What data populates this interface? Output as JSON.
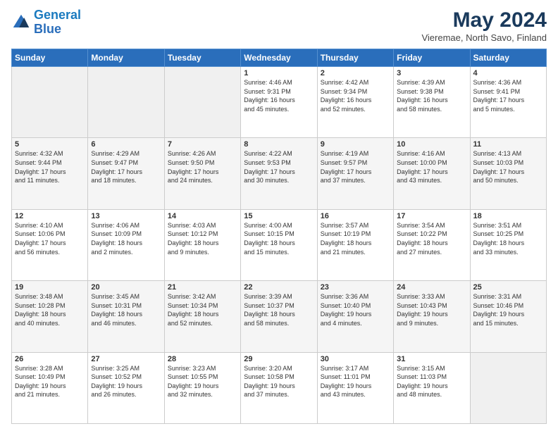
{
  "header": {
    "logo_line1": "General",
    "logo_line2": "Blue",
    "title": "May 2024",
    "subtitle": "Vieremae, North Savo, Finland"
  },
  "weekdays": [
    "Sunday",
    "Monday",
    "Tuesday",
    "Wednesday",
    "Thursday",
    "Friday",
    "Saturday"
  ],
  "weeks": [
    [
      {
        "num": "",
        "info": ""
      },
      {
        "num": "",
        "info": ""
      },
      {
        "num": "",
        "info": ""
      },
      {
        "num": "1",
        "info": "Sunrise: 4:46 AM\nSunset: 9:31 PM\nDaylight: 16 hours\nand 45 minutes."
      },
      {
        "num": "2",
        "info": "Sunrise: 4:42 AM\nSunset: 9:34 PM\nDaylight: 16 hours\nand 52 minutes."
      },
      {
        "num": "3",
        "info": "Sunrise: 4:39 AM\nSunset: 9:38 PM\nDaylight: 16 hours\nand 58 minutes."
      },
      {
        "num": "4",
        "info": "Sunrise: 4:36 AM\nSunset: 9:41 PM\nDaylight: 17 hours\nand 5 minutes."
      }
    ],
    [
      {
        "num": "5",
        "info": "Sunrise: 4:32 AM\nSunset: 9:44 PM\nDaylight: 17 hours\nand 11 minutes."
      },
      {
        "num": "6",
        "info": "Sunrise: 4:29 AM\nSunset: 9:47 PM\nDaylight: 17 hours\nand 18 minutes."
      },
      {
        "num": "7",
        "info": "Sunrise: 4:26 AM\nSunset: 9:50 PM\nDaylight: 17 hours\nand 24 minutes."
      },
      {
        "num": "8",
        "info": "Sunrise: 4:22 AM\nSunset: 9:53 PM\nDaylight: 17 hours\nand 30 minutes."
      },
      {
        "num": "9",
        "info": "Sunrise: 4:19 AM\nSunset: 9:57 PM\nDaylight: 17 hours\nand 37 minutes."
      },
      {
        "num": "10",
        "info": "Sunrise: 4:16 AM\nSunset: 10:00 PM\nDaylight: 17 hours\nand 43 minutes."
      },
      {
        "num": "11",
        "info": "Sunrise: 4:13 AM\nSunset: 10:03 PM\nDaylight: 17 hours\nand 50 minutes."
      }
    ],
    [
      {
        "num": "12",
        "info": "Sunrise: 4:10 AM\nSunset: 10:06 PM\nDaylight: 17 hours\nand 56 minutes."
      },
      {
        "num": "13",
        "info": "Sunrise: 4:06 AM\nSunset: 10:09 PM\nDaylight: 18 hours\nand 2 minutes."
      },
      {
        "num": "14",
        "info": "Sunrise: 4:03 AM\nSunset: 10:12 PM\nDaylight: 18 hours\nand 9 minutes."
      },
      {
        "num": "15",
        "info": "Sunrise: 4:00 AM\nSunset: 10:15 PM\nDaylight: 18 hours\nand 15 minutes."
      },
      {
        "num": "16",
        "info": "Sunrise: 3:57 AM\nSunset: 10:19 PM\nDaylight: 18 hours\nand 21 minutes."
      },
      {
        "num": "17",
        "info": "Sunrise: 3:54 AM\nSunset: 10:22 PM\nDaylight: 18 hours\nand 27 minutes."
      },
      {
        "num": "18",
        "info": "Sunrise: 3:51 AM\nSunset: 10:25 PM\nDaylight: 18 hours\nand 33 minutes."
      }
    ],
    [
      {
        "num": "19",
        "info": "Sunrise: 3:48 AM\nSunset: 10:28 PM\nDaylight: 18 hours\nand 40 minutes."
      },
      {
        "num": "20",
        "info": "Sunrise: 3:45 AM\nSunset: 10:31 PM\nDaylight: 18 hours\nand 46 minutes."
      },
      {
        "num": "21",
        "info": "Sunrise: 3:42 AM\nSunset: 10:34 PM\nDaylight: 18 hours\nand 52 minutes."
      },
      {
        "num": "22",
        "info": "Sunrise: 3:39 AM\nSunset: 10:37 PM\nDaylight: 18 hours\nand 58 minutes."
      },
      {
        "num": "23",
        "info": "Sunrise: 3:36 AM\nSunset: 10:40 PM\nDaylight: 19 hours\nand 4 minutes."
      },
      {
        "num": "24",
        "info": "Sunrise: 3:33 AM\nSunset: 10:43 PM\nDaylight: 19 hours\nand 9 minutes."
      },
      {
        "num": "25",
        "info": "Sunrise: 3:31 AM\nSunset: 10:46 PM\nDaylight: 19 hours\nand 15 minutes."
      }
    ],
    [
      {
        "num": "26",
        "info": "Sunrise: 3:28 AM\nSunset: 10:49 PM\nDaylight: 19 hours\nand 21 minutes."
      },
      {
        "num": "27",
        "info": "Sunrise: 3:25 AM\nSunset: 10:52 PM\nDaylight: 19 hours\nand 26 minutes."
      },
      {
        "num": "28",
        "info": "Sunrise: 3:23 AM\nSunset: 10:55 PM\nDaylight: 19 hours\nand 32 minutes."
      },
      {
        "num": "29",
        "info": "Sunrise: 3:20 AM\nSunset: 10:58 PM\nDaylight: 19 hours\nand 37 minutes."
      },
      {
        "num": "30",
        "info": "Sunrise: 3:17 AM\nSunset: 11:01 PM\nDaylight: 19 hours\nand 43 minutes."
      },
      {
        "num": "31",
        "info": "Sunrise: 3:15 AM\nSunset: 11:03 PM\nDaylight: 19 hours\nand 48 minutes."
      },
      {
        "num": "",
        "info": ""
      }
    ]
  ]
}
